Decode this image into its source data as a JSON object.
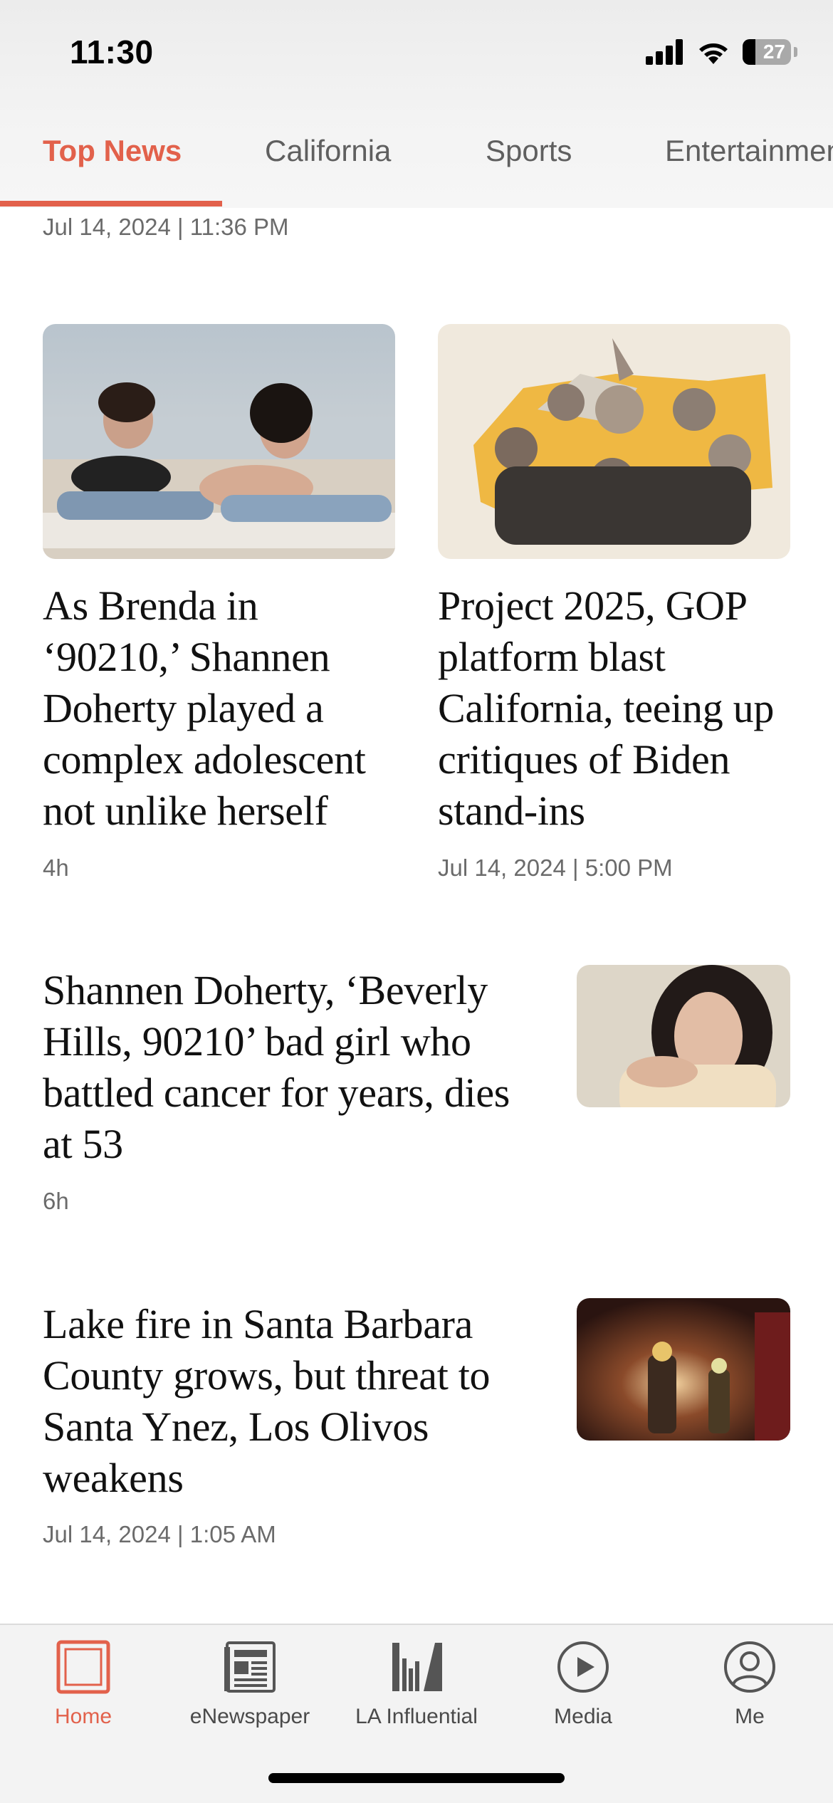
{
  "status_bar": {
    "time": "11:30",
    "battery": "27",
    "icons": [
      "cellular-signal-icon",
      "wifi-icon",
      "battery-icon"
    ]
  },
  "tabs": [
    {
      "label": "Top News",
      "active": true
    },
    {
      "label": "California",
      "active": false
    },
    {
      "label": "Sports",
      "active": false
    },
    {
      "label": "Entertainment",
      "active": false
    }
  ],
  "feed": {
    "top_timestamp": "Jul 14, 2024 | 11:36 PM",
    "cards": [
      {
        "headline": "As Brenda in ‘90210,’ Shannen Doherty played a complex adolescent not unlike herself",
        "meta": "4h",
        "image": "beach-couple-photo"
      },
      {
        "headline": "Project 2025, GOP platform blast California, teeing up critiques of Biden stand-ins",
        "meta": "Jul 14, 2024 | 5:00 PM",
        "image": "politicians-collage-photo"
      }
    ],
    "rows": [
      {
        "headline": "Shannen Doherty, ‘Beverly Hills, 90210’ bad girl who battled cancer for years, dies at 53",
        "meta": "6h",
        "image": "portrait-photo"
      },
      {
        "headline": "Lake fire in Santa Barbara County grows, but threat to Santa Ynez, Los Olivos weakens",
        "meta": "Jul 14, 2024 | 1:05 AM",
        "image": "firefighters-photo"
      }
    ]
  },
  "bottom_nav": [
    {
      "label": "Home",
      "icon": "home-icon",
      "active": true
    },
    {
      "label": "eNewspaper",
      "icon": "newspaper-icon",
      "active": false
    },
    {
      "label": "LA Influential",
      "icon": "books-icon",
      "active": false
    },
    {
      "label": "Media",
      "icon": "play-icon",
      "active": false
    },
    {
      "label": "Me",
      "icon": "profile-icon",
      "active": false
    }
  ],
  "colors": {
    "accent": "#e2614b",
    "text": "#111111",
    "meta": "#6b6b6b"
  }
}
